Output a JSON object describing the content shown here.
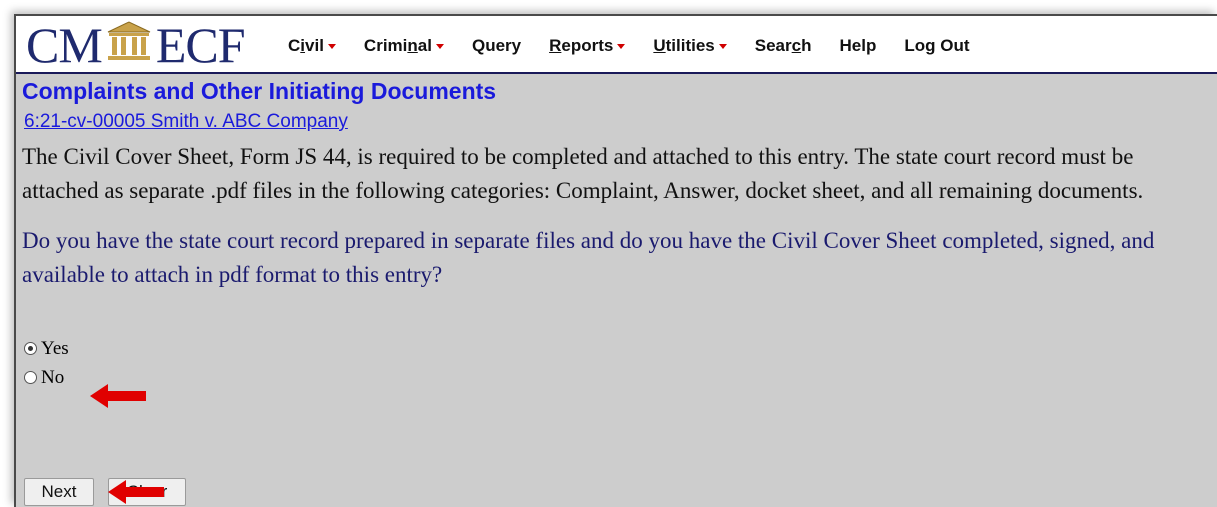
{
  "logo": {
    "left": "CM",
    "right": "ECF"
  },
  "menu": [
    {
      "label": "Civil",
      "underline_char": "i",
      "dropdown": true
    },
    {
      "label": "Criminal",
      "underline_char": "n",
      "dropdown": true
    },
    {
      "label": "Query",
      "underline_char": "",
      "dropdown": false
    },
    {
      "label": "Reports",
      "underline_char": "R",
      "dropdown": true
    },
    {
      "label": "Utilities",
      "underline_char": "U",
      "dropdown": true
    },
    {
      "label": "Search",
      "underline_char": "c",
      "dropdown": false
    },
    {
      "label": "Help",
      "underline_char": "",
      "dropdown": false
    },
    {
      "label": "Log Out",
      "underline_char": "",
      "dropdown": false
    }
  ],
  "main": {
    "title": "Complaints and Other Initiating Documents",
    "case_link": "6:21-cv-00005 Smith v. ABC Company",
    "instructions": "The Civil Cover Sheet, Form JS 44, is required to be completed and attached to this entry. The state court record must be attached as separate .pdf files in the following categories: Complaint, Answer, docket sheet, and all remaining documents.",
    "question": "Do you have the state court record prepared in separate files and do you have the Civil Cover Sheet completed, signed, and available to attach in pdf format to this entry?",
    "options": [
      {
        "label": "Yes",
        "selected": true
      },
      {
        "label": "No",
        "selected": false
      }
    ],
    "next_label": "Next",
    "clear_label": "Clear"
  },
  "colors": {
    "link": "#1a1adb",
    "arrow": "#e00000",
    "logo": "#1f2a6e",
    "background": "#cdcdcd"
  }
}
